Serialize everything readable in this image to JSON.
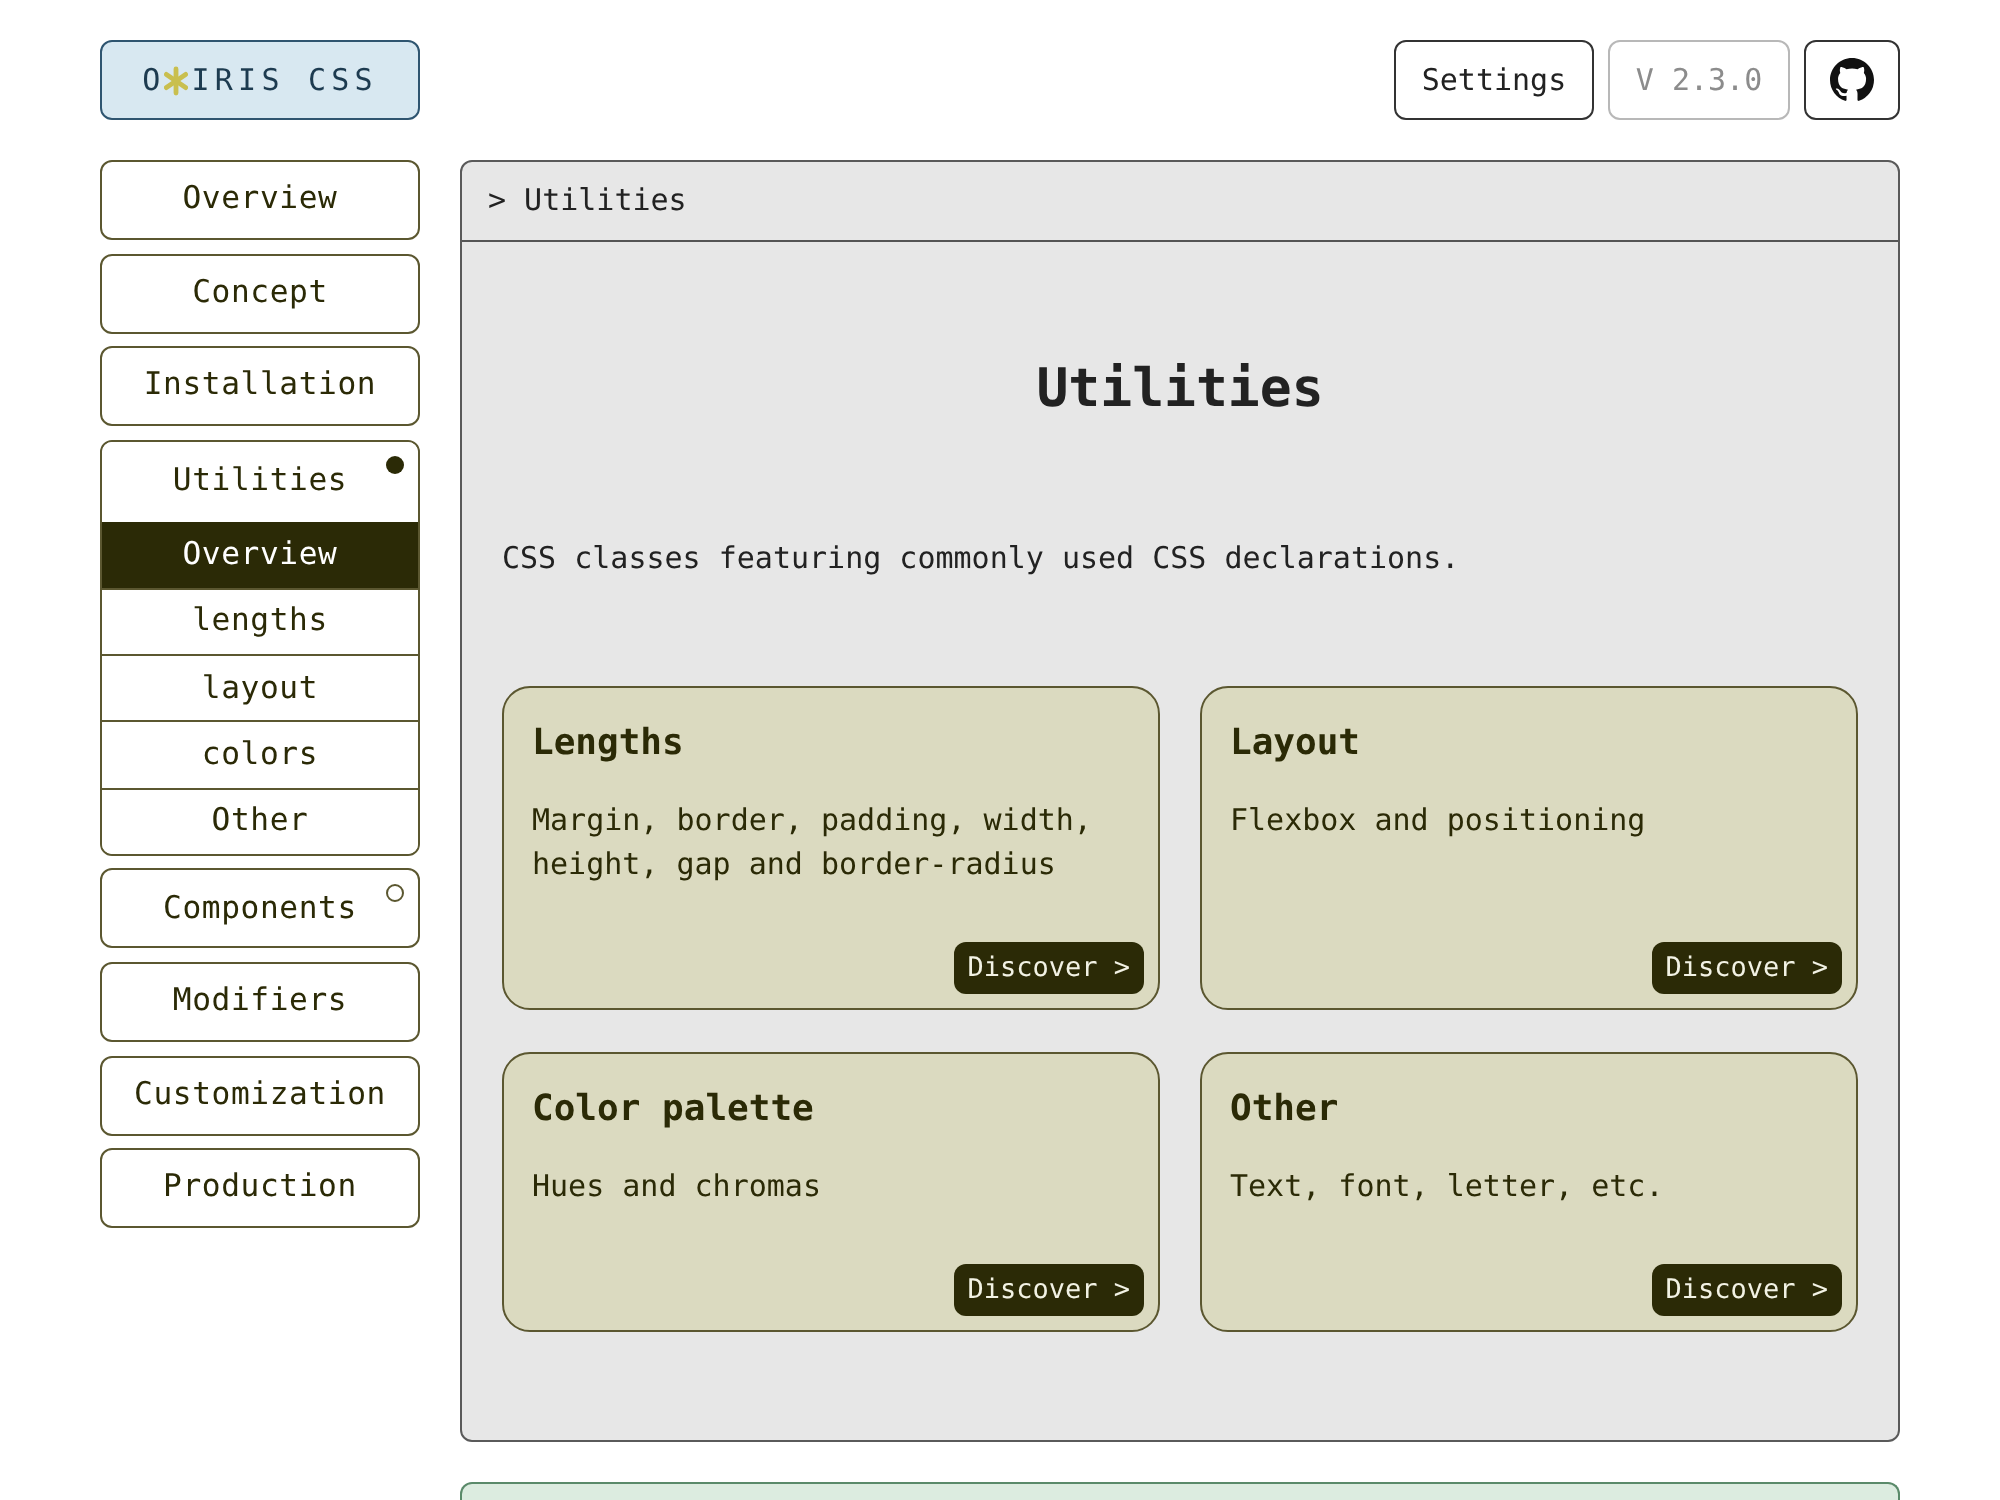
{
  "header": {
    "logo": {
      "before": "O",
      "after": "IRIS CSS"
    },
    "actions": [
      {
        "kind": "button",
        "label": "Settings"
      },
      {
        "kind": "version",
        "label": "V 2.3.0"
      },
      {
        "kind": "icon-button"
      }
    ]
  },
  "sidebar": {
    "items": [
      {
        "label": "Overview",
        "selected": false
      },
      {
        "label": "Concept",
        "selected": false
      },
      {
        "label": "Installation",
        "selected": false
      },
      {
        "label": "Utilities",
        "selected": false,
        "expanded": true,
        "children": [
          {
            "label": "Overview",
            "selected": true
          },
          {
            "label": "lengths",
            "selected": false
          },
          {
            "label": "layout",
            "selected": false
          },
          {
            "label": "colors",
            "selected": false
          },
          {
            "label": "Other",
            "selected": false
          }
        ]
      },
      {
        "label": "Components",
        "selected": false,
        "expanded": false
      },
      {
        "label": "Modifiers",
        "selected": false
      },
      {
        "label": "Customization",
        "selected": false
      },
      {
        "label": "Production",
        "selected": false
      }
    ]
  },
  "main": {
    "breadcrumb": "> Utilities",
    "title": "Utilities",
    "description": "CSS classes featuring commonly used CSS declarations.",
    "cards": [
      {
        "title": "Lengths",
        "description": "Margin, border, padding, width, height, gap and border-radius",
        "button": "Discover >"
      },
      {
        "title": "Layout",
        "description": "Flexbox and positioning",
        "button": "Discover >"
      },
      {
        "title": "Color palette",
        "description": "Hues and chromas",
        "button": "Discover >"
      },
      {
        "title": "Other",
        "description": "Text, font, letter, etc.",
        "button": "Discover >"
      }
    ]
  },
  "panels_below": [
    {
      "kind": "success"
    }
  ]
}
